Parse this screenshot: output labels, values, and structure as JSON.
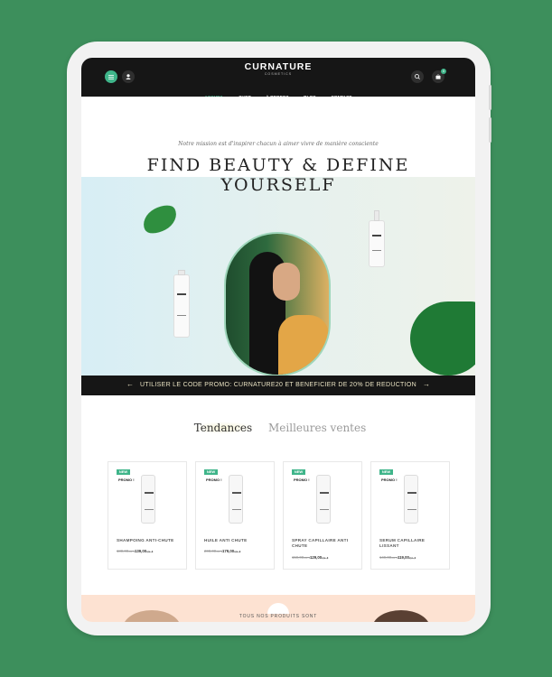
{
  "header": {
    "logo": "CURNATURE",
    "logo_sub": "COSMETICS",
    "cart_count": "0",
    "nav": [
      "ACCUEIL",
      "SHOP",
      "À PROPOS",
      "BLOG",
      "CONTACT"
    ],
    "active_nav": "ACCUEIL",
    "icons": [
      "menu-icon",
      "user-icon",
      "search-icon",
      "cart-icon"
    ]
  },
  "hero": {
    "mission": "Notre mission est d'inspirer chacun à aimer vivre de manière consciente",
    "title_line1": "FIND BEAUTY & DEFINE",
    "title_line2": "YOURSELF"
  },
  "promo": {
    "text": "UTILISER LE CODE PROMO: CURNATURE20 ET BENEFICIER DE 20% DE REDUCTION",
    "prev": "←",
    "next": "→"
  },
  "tabs": [
    "Tendances",
    "Meilleures ventes"
  ],
  "products": [
    {
      "new_badge": "NEW",
      "promo_badge": "PROMO !",
      "name": "SHAMPOING ANTI-CHUTE",
      "old_price": "180,00د.ت",
      "new_price": "139,00د.ت"
    },
    {
      "new_badge": "NEW",
      "promo_badge": "PROMO !",
      "name": "HUILE ANTI CHUTE",
      "old_price": "200,00د.ت",
      "new_price": "179,00د.ت"
    },
    {
      "new_badge": "NEW",
      "promo_badge": "PROMO !",
      "name": "SPRAY CAPILLAIRE ANTI CHUTE",
      "old_price": "159,00د.ت",
      "new_price": "129,00د.ت"
    },
    {
      "new_badge": "NEW",
      "promo_badge": "PROMO !",
      "name": "SERUM CAPILLAIRE LISSANT",
      "old_price": "149,00د.ت",
      "new_price": "119,00د.ت"
    }
  ],
  "bottom": {
    "text": "TOUS NOS PRODUITS SONT"
  },
  "colors": {
    "background": "#3d8f5c",
    "accent": "#3fb58a",
    "header": "#161616",
    "promo_text": "#e9e2c2"
  }
}
